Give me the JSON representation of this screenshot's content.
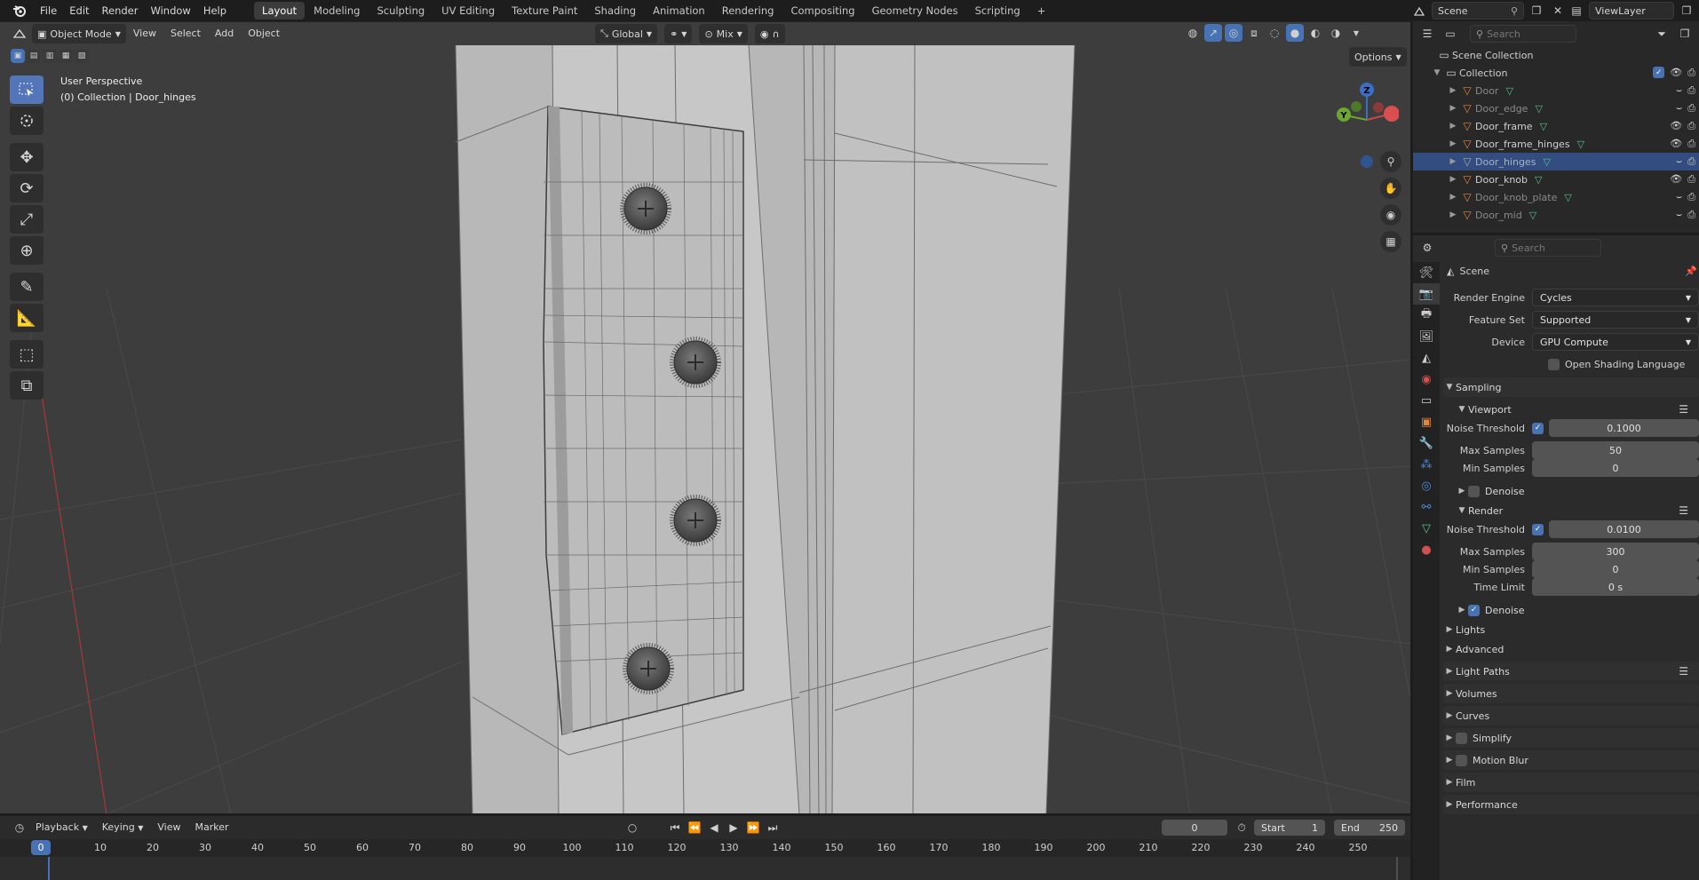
{
  "menubar": {
    "items": [
      "File",
      "Edit",
      "Render",
      "Window",
      "Help"
    ],
    "workspaces": [
      "Layout",
      "Modeling",
      "Sculpting",
      "UV Editing",
      "Texture Paint",
      "Shading",
      "Animation",
      "Rendering",
      "Compositing",
      "Geometry Nodes",
      "Scripting"
    ],
    "active_workspace": "Layout",
    "add_tab": "+",
    "scene": "Scene",
    "view_layer": "ViewLayer"
  },
  "viewport": {
    "mode": "Object Mode",
    "menus": [
      "View",
      "Select",
      "Add",
      "Object"
    ],
    "transform_orientation": "Global",
    "snap": "Mix",
    "options": "Options",
    "perspective": "User Perspective",
    "context": "(0) Collection | Door_hinges",
    "gizmo_axes": {
      "x": "",
      "y": "Y",
      "z": "Z"
    }
  },
  "outliner": {
    "search_placeholder": "Search",
    "root": "Scene Collection",
    "collection": "Collection",
    "objects": [
      {
        "name": "Door",
        "dim": true,
        "selected": false
      },
      {
        "name": "Door_edge",
        "dim": true,
        "selected": false
      },
      {
        "name": "Door_frame",
        "dim": false,
        "selected": false
      },
      {
        "name": "Door_frame_hinges",
        "dim": false,
        "selected": false
      },
      {
        "name": "Door_hinges",
        "dim": true,
        "selected": true
      },
      {
        "name": "Door_knob",
        "dim": false,
        "selected": false
      },
      {
        "name": "Door_knob_plate",
        "dim": true,
        "selected": false
      },
      {
        "name": "Door_mid",
        "dim": true,
        "selected": false
      }
    ]
  },
  "properties": {
    "search_placeholder": "Search",
    "context": "Scene",
    "render_engine_label": "Render Engine",
    "render_engine": "Cycles",
    "feature_set_label": "Feature Set",
    "feature_set": "Supported",
    "device_label": "Device",
    "device": "GPU Compute",
    "osl_label": "Open Shading Language",
    "sampling": "Sampling",
    "viewport": {
      "title": "Viewport",
      "noise_threshold_label": "Noise Threshold",
      "noise_threshold": "0.1000",
      "max_samples_label": "Max Samples",
      "max_samples": "50",
      "min_samples_label": "Min Samples",
      "min_samples": "0",
      "denoise_label": "Denoise"
    },
    "render": {
      "title": "Render",
      "noise_threshold_label": "Noise Threshold",
      "noise_threshold": "0.0100",
      "max_samples_label": "Max Samples",
      "max_samples": "300",
      "min_samples_label": "Min Samples",
      "min_samples": "0",
      "time_limit_label": "Time Limit",
      "time_limit": "0 s",
      "denoise_label": "Denoise"
    },
    "subpanels": [
      "Lights",
      "Advanced"
    ],
    "panels": [
      "Light Paths",
      "Volumes",
      "Curves",
      "Simplify",
      "Motion Blur",
      "Film",
      "Performance"
    ]
  },
  "timeline": {
    "menus": [
      "Playback",
      "Keying",
      "View",
      "Marker"
    ],
    "current_frame": "0",
    "start_label": "Start",
    "start": "1",
    "end_label": "End",
    "end": "250",
    "ticks": [
      "0",
      "10",
      "20",
      "30",
      "40",
      "50",
      "60",
      "70",
      "80",
      "90",
      "100",
      "110",
      "120",
      "130",
      "140",
      "150",
      "160",
      "170",
      "180",
      "190",
      "200",
      "210",
      "220",
      "230",
      "240",
      "250"
    ],
    "playhead": "0"
  },
  "colors": {
    "accent": "#4772b3",
    "selection": "#334d80",
    "mesh_icon": "#e0873c",
    "mesh_data_icon": "#4fc28f"
  }
}
